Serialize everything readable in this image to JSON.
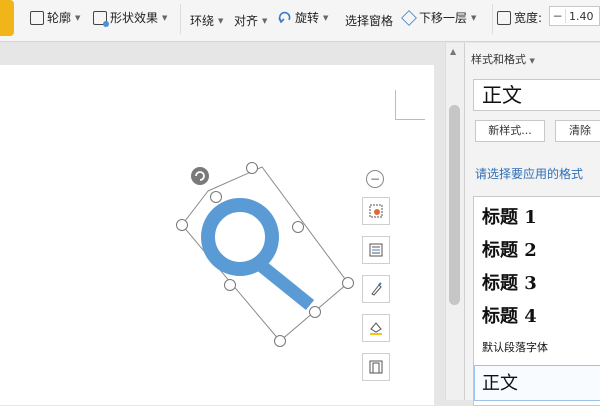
{
  "ribbon": {
    "outline_label": "轮廓",
    "shape_effects_label": "形状效果",
    "wrap_label": "环绕",
    "align_label": "对齐",
    "rotate_label": "旋转",
    "selection_pane_label": "选择窗格",
    "send_backward_label": "下移一层",
    "width_label": "宽度:",
    "width_value": "1.40"
  },
  "styles_pane": {
    "title": "样式和格式",
    "current_style": "正文",
    "new_style_button": "新样式...",
    "clear_button": "清除",
    "hint": "请选择要应用的格式",
    "styles": [
      {
        "label": "标题  1"
      },
      {
        "label": "标题  2"
      },
      {
        "label": "标题  3"
      },
      {
        "label": "标题  4"
      },
      {
        "label": "默认段落字体"
      },
      {
        "label": "正文"
      }
    ]
  },
  "shape": {
    "kind": "magnifier",
    "fill_color": "#5b9bd5"
  },
  "floating_toolbar": {
    "icons": [
      "layout-options-icon",
      "wrap-text-icon",
      "fill-icon",
      "outline-color-icon",
      "frame-icon"
    ]
  }
}
